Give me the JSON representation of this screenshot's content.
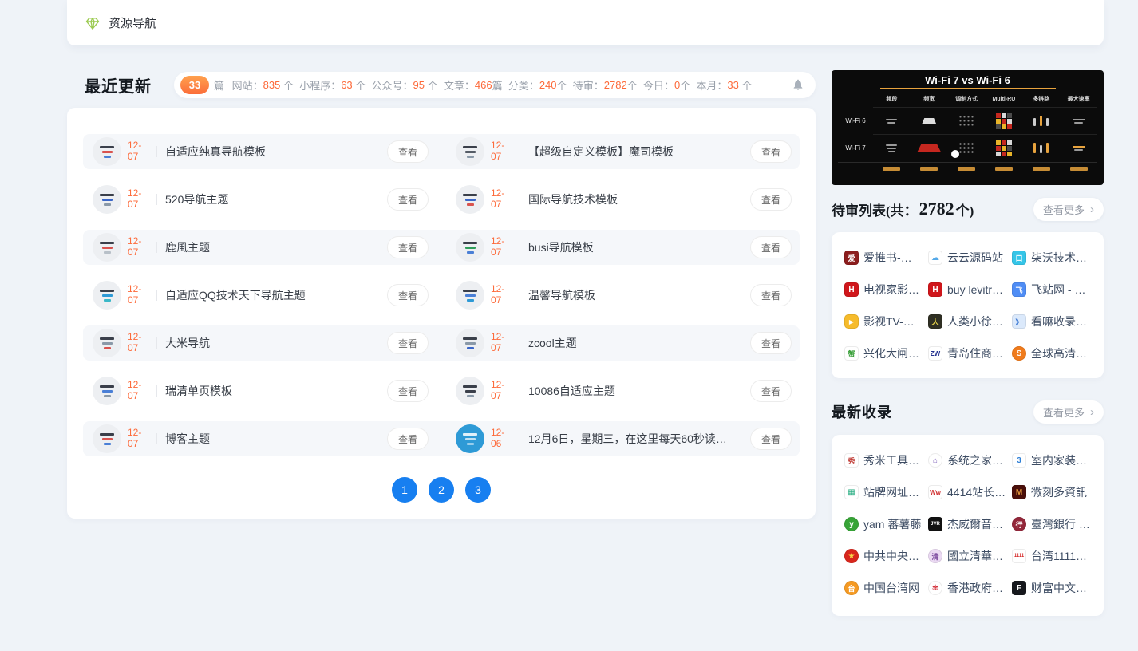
{
  "topbar": {
    "title": "资源导航"
  },
  "recent": {
    "title": "最近更新",
    "badge": "33",
    "badge_unit": "篇 ",
    "view_label": "查看",
    "stats": [
      {
        "label": "网站：",
        "value": "835",
        "unit": " 个  "
      },
      {
        "label": "小程序：",
        "value": "63",
        "unit": " 个  "
      },
      {
        "label": "公众号：",
        "value": "95",
        "unit": " 个  "
      },
      {
        "label": "文章：",
        "value": "466",
        "unit": "篇  "
      },
      {
        "label": "分类：",
        "value": "240",
        "unit": "个  "
      },
      {
        "label": "待审：",
        "value": "2782",
        "unit": "个  "
      },
      {
        "label": "今日：",
        "value": "0",
        "unit": "个  "
      },
      {
        "label": "本月：",
        "value": "33",
        "unit": " 个"
      }
    ],
    "rows": [
      {
        "left": {
          "d1": "12-",
          "d2": "07",
          "title": "自适应纯真导航模板",
          "kind": "shot",
          "tb": "#edeff2",
          "a1": "#3a3f4a",
          "a2": "#d9534f",
          "a3": "#4a7fd6"
        },
        "right": {
          "d1": "12-",
          "d2": "07",
          "title": "【超级自定义模板】魔司模板",
          "kind": "shot",
          "tb": "#edeff2",
          "a1": "#3a3f4a",
          "a2": "#555c66",
          "a3": "#8a99a8"
        }
      },
      {
        "left": {
          "d1": "12-",
          "d2": "07",
          "title": "520导航主题",
          "kind": "shot",
          "tb": "#edeff2",
          "a1": "#3a3f4a",
          "a2": "#3a66c8",
          "a3": "#8a99a8"
        },
        "right": {
          "d1": "12-",
          "d2": "07",
          "title": "国际导航技术模板",
          "kind": "shot",
          "tb": "#edeff2",
          "a1": "#3a3f4a",
          "a2": "#3a66c8",
          "a3": "#d9534f"
        }
      },
      {
        "left": {
          "d1": "12-",
          "d2": "07",
          "title": "鹿風主题",
          "kind": "shot",
          "tb": "#edeff2",
          "a1": "#3a3f4a",
          "a2": "#d9534f",
          "a3": "#b8c0c8"
        },
        "right": {
          "d1": "12-",
          "d2": "07",
          "title": "busi导航模板",
          "kind": "shot",
          "tb": "#edeff2",
          "a1": "#3a3f4a",
          "a2": "#2f9e5a",
          "a3": "#4a7fd6"
        }
      },
      {
        "left": {
          "d1": "12-",
          "d2": "07",
          "title": "自适应QQ技术天下导航主题",
          "kind": "shot",
          "tb": "#edeff2",
          "a1": "#3a3f4a",
          "a2": "#2e9ad6",
          "a3": "#3ab8c8"
        },
        "right": {
          "d1": "12-",
          "d2": "07",
          "title": "温馨导航模板",
          "kind": "shot",
          "tb": "#edeff2",
          "a1": "#3a3f4a",
          "a2": "#4a7fd6",
          "a3": "#2e9ad6"
        }
      },
      {
        "left": {
          "d1": "12-",
          "d2": "07",
          "title": "大米导航",
          "kind": "shot",
          "tb": "#edeff2",
          "a1": "#3a3f4a",
          "a2": "#8a99a8",
          "a3": "#d9534f"
        },
        "right": {
          "d1": "12-",
          "d2": "07",
          "title": "zcool主题",
          "kind": "shot",
          "tb": "#edeff2",
          "a1": "#3a3f4a",
          "a2": "#8a99a8",
          "a3": "#3a66c8"
        }
      },
      {
        "left": {
          "d1": "12-",
          "d2": "07",
          "title": "瑞清单页模板",
          "kind": "shot",
          "tb": "#edeff2",
          "a1": "#3a3f4a",
          "a2": "#4a7fd6",
          "a3": "#8a99a8"
        },
        "right": {
          "d1": "12-",
          "d2": "07",
          "title": "10086自适应主题",
          "kind": "shot",
          "tb": "#edeff2",
          "a1": "#3a3f4a",
          "a2": "#3a3f4a",
          "a3": "#8a99a8"
        }
      },
      {
        "left": {
          "d1": "12-",
          "d2": "07",
          "title": "博客主题",
          "kind": "shot",
          "tb": "#edeff2",
          "a1": "#3a3f4a",
          "a2": "#d9534f",
          "a3": "#4a7fd6"
        },
        "right": {
          "d1": "12-",
          "d2": "06",
          "title": "12月6日，星期三，在这里每天60秒读…",
          "kind": "logo",
          "tb": "#2e9ad6",
          "a1": "#ffffffd9",
          "a2": "#ffffffb3",
          "a3": "#ffffff80"
        }
      }
    ],
    "pages": [
      "1",
      "2",
      "3"
    ],
    "accent_blue": "#177ff0",
    "accent_orange": "#fd6a3a"
  },
  "sidebar": {
    "wifi": {
      "title": "Wi-Fi 7 vs Wi-Fi 6",
      "columns": [
        "频段",
        "频宽",
        "调制方式",
        "Multi-RU",
        "多链路",
        "最大速率"
      ],
      "rows": [
        "Wi-Fi 6",
        "Wi-Fi 7"
      ]
    },
    "pending": {
      "title_prefix": "待审列表(共：",
      "count": "2782",
      "title_suffix": "个)",
      "more_label": "查看更多",
      "chevron": "›",
      "items": [
        {
          "label": "爱推书-…",
          "glyph": "爱",
          "bg": "#8c1d1d",
          "fg": "#ffffff",
          "fs": "9px"
        },
        {
          "label": "云云源码站",
          "glyph": "☁",
          "bg": "#ffffff",
          "fg": "#55a9e8"
        },
        {
          "label": "柒沃技术…",
          "glyph": "口",
          "bg": "#35c5e8",
          "fg": "#ffffff",
          "fs": "9px"
        },
        {
          "label": "电视家影…",
          "glyph": "H",
          "bg": "#d0161b",
          "fg": "#ffffff"
        },
        {
          "label": "buy levitr…",
          "glyph": "H",
          "bg": "#d0161b",
          "fg": "#ffffff"
        },
        {
          "label": "飞站网 - …",
          "glyph": "飞",
          "bg": "#4f8df5",
          "fg": "#ffffff",
          "fs": "9px"
        },
        {
          "label": "影视TV-…",
          "glyph": "▶",
          "bg": "#f6bb2b",
          "fg": "#ffffff",
          "fs": "8px",
          "r": "5px"
        },
        {
          "label": "人类小徐…",
          "glyph": "人",
          "bg": "#2f2f23",
          "fg": "#e8d44a",
          "fs": "9px"
        },
        {
          "label": "看嘛收录…",
          "glyph": "》",
          "bg": "#dbe9fb",
          "fg": "#2f6fd0",
          "fs": "9px"
        },
        {
          "label": "兴化大闸…",
          "glyph": "蟹",
          "bg": "#ffffff",
          "fg": "#3aa03a",
          "fs": "9px"
        },
        {
          "label": "青岛住商…",
          "glyph": "ZW",
          "bg": "#ffffff",
          "fg": "#23318f",
          "fs": "8px"
        },
        {
          "label": "全球高清…",
          "glyph": "S",
          "bg": "#f07b1c",
          "fg": "#ffffff",
          "r": "50%"
        }
      ]
    },
    "latest": {
      "title": "最新收录",
      "more_label": "查看更多",
      "chevron": "›",
      "items": [
        {
          "label": "秀米工具…",
          "glyph": "秀",
          "bg": "#ffffff",
          "fg": "#c2403a",
          "fs": "9px"
        },
        {
          "label": "系统之家…",
          "glyph": "⌂",
          "bg": "#ffffff",
          "fg": "#7a5ab8",
          "r": "50%"
        },
        {
          "label": "室内家装…",
          "glyph": "3",
          "bg": "#ffffff",
          "fg": "#2e7fd6"
        },
        {
          "label": "站牌网址…",
          "glyph": "▦",
          "bg": "#ffffff",
          "fg": "#1aa87a"
        },
        {
          "label": "4414站长…",
          "glyph": "Ww",
          "bg": "#ffffff",
          "fg": "#d03030",
          "fs": "8px"
        },
        {
          "label": "微刻多資訊",
          "glyph": "M",
          "bg": "#4a0f0a",
          "fg": "#e89c3d"
        },
        {
          "label": "yam 蕃薯藤",
          "glyph": "y",
          "bg": "#37a437",
          "fg": "#ffffff",
          "r": "50%"
        },
        {
          "label": "杰威爾音…",
          "glyph": "JVR",
          "bg": "#111111",
          "fg": "#ffffff",
          "fs": "6px"
        },
        {
          "label": "臺灣銀行 …",
          "glyph": "行",
          "bg": "#93273a",
          "fg": "#ffffff",
          "fs": "9px",
          "r": "50%"
        },
        {
          "label": "中共中央…",
          "glyph": "★",
          "bg": "#d8261c",
          "fg": "#f7d648",
          "r": "50%"
        },
        {
          "label": "國立清華…",
          "glyph": "清",
          "bg": "#ead9f2",
          "fg": "#7c4a9e",
          "fs": "9px",
          "r": "50%"
        },
        {
          "label": "台湾1111…",
          "glyph": "1111",
          "bg": "#ffffff",
          "fg": "#d42222",
          "fs": "6px"
        },
        {
          "label": "中国台湾网",
          "glyph": "台",
          "bg": "#f59a23",
          "fg": "#ffffff",
          "fs": "9px",
          "r": "50%"
        },
        {
          "label": "香港政府…",
          "glyph": "✾",
          "bg": "#ffffff",
          "fg": "#d4323c",
          "r": "50%"
        },
        {
          "label": "财富中文…",
          "glyph": "F",
          "bg": "#16181d",
          "fg": "#ffffff"
        }
      ]
    }
  }
}
